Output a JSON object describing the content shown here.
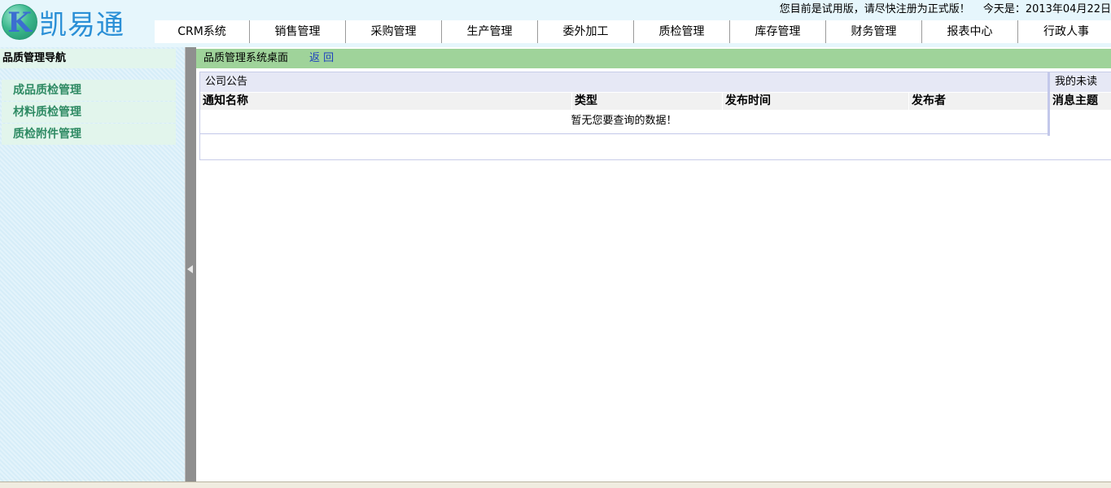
{
  "header": {
    "logo_letter": "K",
    "logo_text": "凯易通",
    "trial_notice": "您目前是试用版，请尽快注册为正式版！",
    "today_label": "今天是：",
    "today_date": "2013年04月22日"
  },
  "menu": {
    "items": [
      "CRM系统",
      "销售管理",
      "采购管理",
      "生产管理",
      "委外加工",
      "质检管理",
      "库存管理",
      "财务管理",
      "报表中心",
      "行政人事"
    ]
  },
  "sidebar": {
    "title": "品质管理导航",
    "items": [
      "成品质检管理",
      "材料质检管理",
      "质检附件管理"
    ]
  },
  "main": {
    "breadcrumb": "品质管理系统桌面",
    "back_label": "返 回",
    "announcements": {
      "title": "公司公告",
      "columns": [
        "通知名称",
        "类型",
        "发布时间",
        "发布者"
      ],
      "empty_text": "暂无您要查询的数据！"
    },
    "messages": {
      "title": "我的未读",
      "columns": [
        "消息主题"
      ]
    }
  },
  "icons": {
    "splitter": "collapse-left-arrow-icon"
  },
  "colors": {
    "header_bg": "#e6f6fc",
    "breadcrumb_bg": "#9fd39a",
    "nav_item_text": "#2e8a63",
    "back_link": "#1d3fbf"
  }
}
